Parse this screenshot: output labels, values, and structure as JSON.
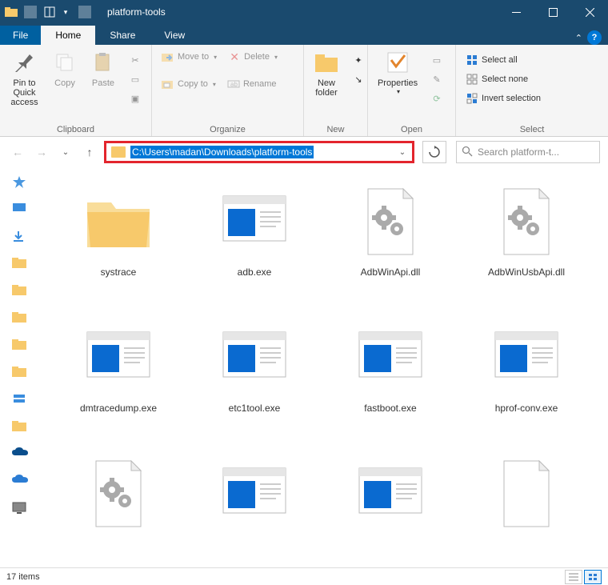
{
  "titlebar": {
    "title": "platform-tools"
  },
  "tabs": {
    "file": "File",
    "home": "Home",
    "share": "Share",
    "view": "View"
  },
  "ribbon": {
    "clipboard": {
      "label": "Clipboard",
      "pin": "Pin to Quick access",
      "copy": "Copy",
      "paste": "Paste"
    },
    "organize": {
      "label": "Organize",
      "moveto": "Move to",
      "copyto": "Copy to",
      "delete": "Delete",
      "rename": "Rename"
    },
    "new": {
      "label": "New",
      "newfolder": "New folder"
    },
    "open": {
      "label": "Open",
      "properties": "Properties"
    },
    "select": {
      "label": "Select",
      "all": "Select all",
      "none": "Select none",
      "invert": "Invert selection"
    }
  },
  "address": {
    "path": "C:\\Users\\madan\\Downloads\\platform-tools"
  },
  "search": {
    "placeholder": "Search platform-t..."
  },
  "items": [
    {
      "name": "systrace",
      "type": "folder"
    },
    {
      "name": "adb.exe",
      "type": "exe"
    },
    {
      "name": "AdbWinApi.dll",
      "type": "dll"
    },
    {
      "name": "AdbWinUsbApi.dll",
      "type": "dll"
    },
    {
      "name": "dmtracedump.exe",
      "type": "exe"
    },
    {
      "name": "etc1tool.exe",
      "type": "exe"
    },
    {
      "name": "fastboot.exe",
      "type": "exe"
    },
    {
      "name": "hprof-conv.exe",
      "type": "exe"
    },
    {
      "name": "",
      "type": "dll"
    },
    {
      "name": "",
      "type": "exe"
    },
    {
      "name": "",
      "type": "exe"
    },
    {
      "name": "",
      "type": "file"
    }
  ],
  "status": {
    "count": "17 items"
  }
}
